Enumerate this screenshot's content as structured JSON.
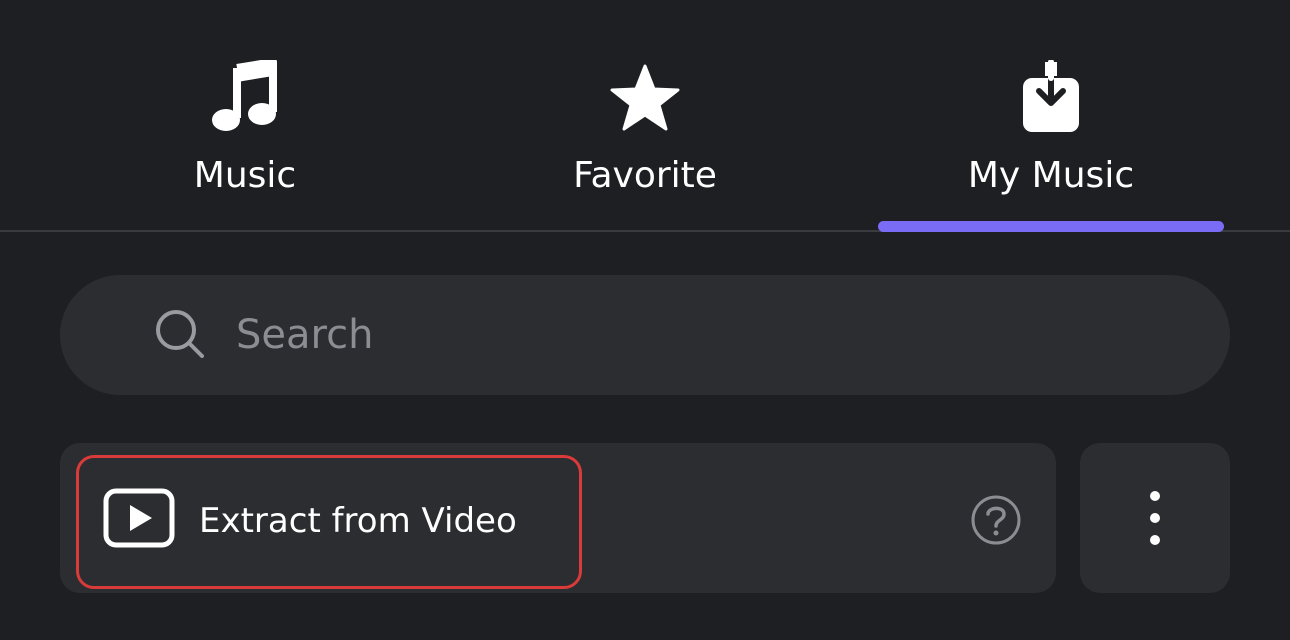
{
  "tabs": [
    {
      "label": "Music",
      "icon": "music-note-icon",
      "active": false
    },
    {
      "label": "Favorite",
      "icon": "star-icon",
      "active": false
    },
    {
      "label": "My Music",
      "icon": "download-tray-icon",
      "active": true
    }
  ],
  "search": {
    "placeholder": "Search",
    "value": ""
  },
  "extract": {
    "label": "Extract from Video",
    "icon": "video-play-icon"
  },
  "help": {
    "icon": "question-circle-icon"
  },
  "more": {
    "icon": "more-vertical-icon"
  },
  "colors": {
    "background": "#1e1f22",
    "surface": "#2c2d31",
    "accent": "#7b6cf6",
    "highlight": "#d93a3a",
    "placeholder": "#8c8d92"
  }
}
